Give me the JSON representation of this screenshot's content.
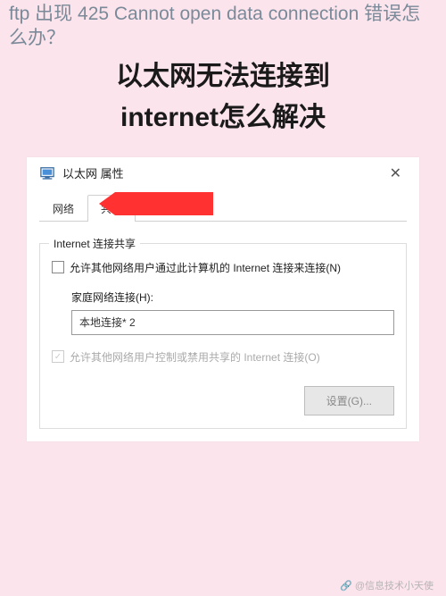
{
  "top_line": "ftp 出现 425 Cannot open data connection 错误怎么办？",
  "title_line1": "以太网无法连接到",
  "title_line2": "internet怎么解决",
  "dialog": {
    "title": "以太网 属性",
    "tabs": {
      "network": "网络",
      "sharing": "共享"
    },
    "group_title": "Internet 连接共享",
    "check1": "允许其他网络用户通过此计算机的 Internet 连接来连接(N)",
    "home_label": "家庭网络连接(H):",
    "home_value": "本地连接* 2",
    "check2": "允许其他网络用户控制或禁用共享的 Internet 连接(O)",
    "settings_btn": "设置(G)..."
  },
  "watermark": "🔗 @信息技术小天使"
}
